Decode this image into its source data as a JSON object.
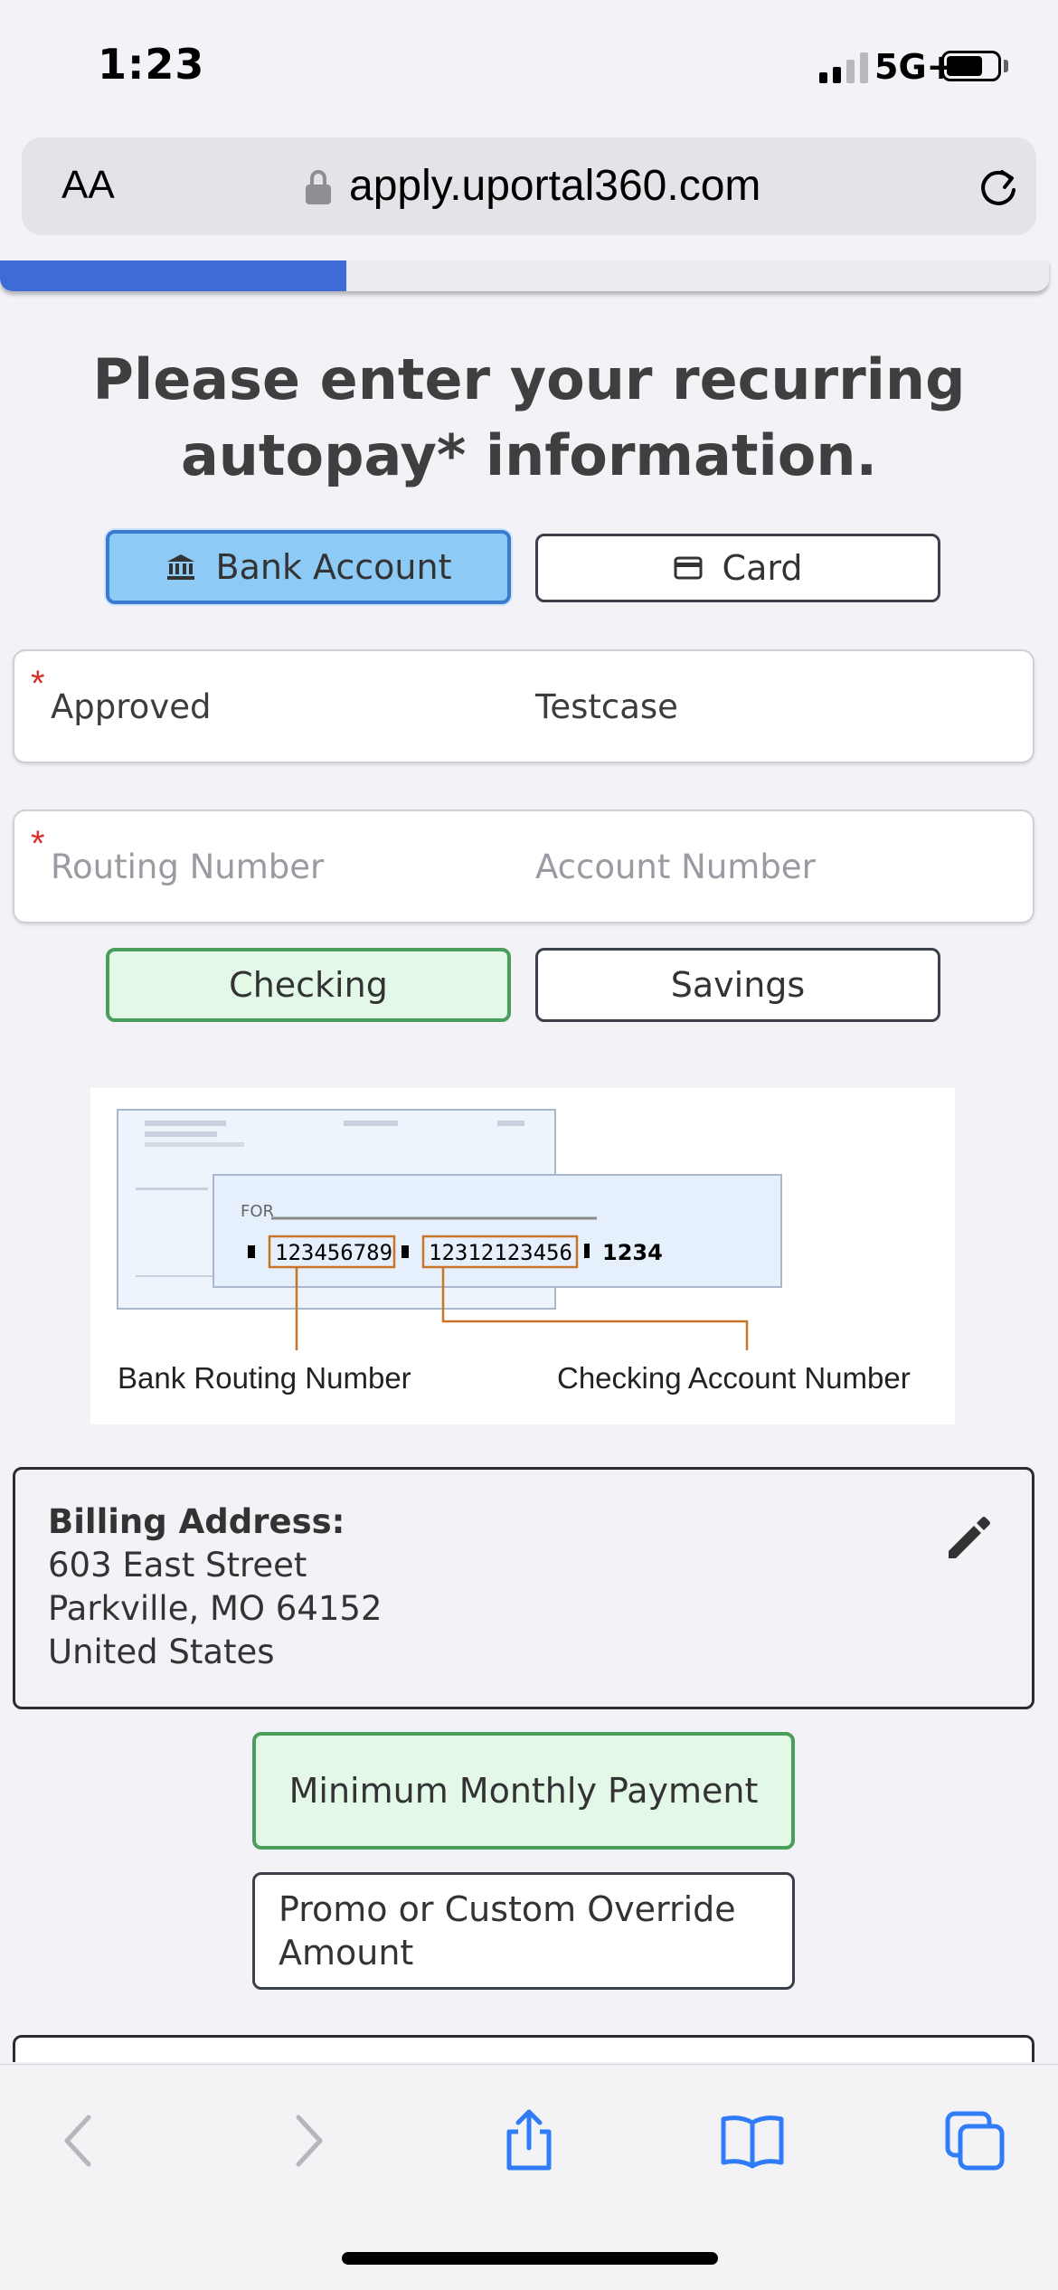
{
  "status_bar": {
    "time": "1:23",
    "network": "5G+"
  },
  "browser": {
    "text_size_label": "AA",
    "url": "apply.uportal360.com"
  },
  "progress": {
    "fraction": 0.33,
    "color": "#3d6cd6"
  },
  "heading": "Please enter your recurring autopay* information.",
  "payment_method": {
    "options": [
      {
        "label": "Bank Account",
        "icon": "bank-icon",
        "selected": true
      },
      {
        "label": "Card",
        "icon": "card-icon",
        "selected": false
      }
    ]
  },
  "name_fields": {
    "first_name_value": "Approved",
    "last_name_value": "Testcase"
  },
  "bank_fields": {
    "routing_placeholder": "Routing Number",
    "account_placeholder": "Account Number"
  },
  "account_type": {
    "options": [
      {
        "label": "Checking",
        "selected": true
      },
      {
        "label": "Savings",
        "selected": false
      }
    ]
  },
  "check_image": {
    "routing_digits": "123456789",
    "account_digits": "12312123456",
    "check_number": "1234",
    "routing_caption": "Bank Routing Number",
    "account_caption": "Checking Account Number",
    "for_label": "FOR"
  },
  "billing_address": {
    "label": "Billing Address:",
    "line1": "603 East Street",
    "line2": "Parkville, MO 64152",
    "line3": "United States"
  },
  "payment_amount": {
    "options": [
      {
        "label": "Minimum Monthly Payment",
        "selected": true
      },
      {
        "label": "Promo or Custom Override Amount",
        "selected": false
      }
    ]
  },
  "colors": {
    "selected_blue": "#8dcaf5",
    "selected_green": "#e4f8e8",
    "required_star": "#d9302c",
    "toolbar_icon": "#2f7cf6"
  }
}
